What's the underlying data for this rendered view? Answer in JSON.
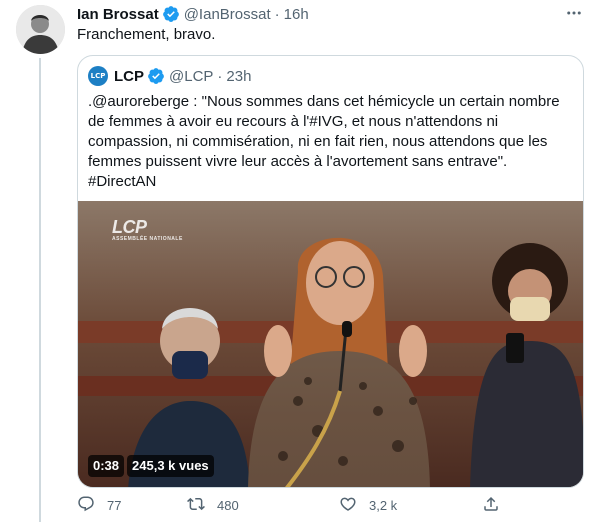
{
  "tweet": {
    "author_name": "Ian Brossat",
    "author_handle": "@IanBrossat",
    "separator": "·",
    "time": "16h",
    "text": "Franchement, bravo."
  },
  "quote": {
    "author_name": "LCP",
    "author_handle": "@LCP",
    "separator": "·",
    "time": "23h",
    "avatar_text": "LCP",
    "text": ".@auroreberge : \"Nous sommes dans cet hémicycle un certain nombre de femmes à avoir eu recours à l'#IVG, et nous n'attendons ni compassion, ni commisération, ni en fait rien, nous attendons que les femmes puissent vivre leur accès à l'avortement sans entrave\". #DirectAN",
    "video": {
      "watermark": "LCP",
      "watermark_sub": "ASSEMBLÉE NATIONALE",
      "duration": "0:38",
      "views": "245,3 k vues"
    }
  },
  "actions": {
    "reply_count": "77",
    "retweet_count": "480",
    "like_count": "3,2 k"
  },
  "colors": {
    "verified": "#1d9bf0",
    "secondary_text": "#536471",
    "border": "#cfd9de"
  }
}
